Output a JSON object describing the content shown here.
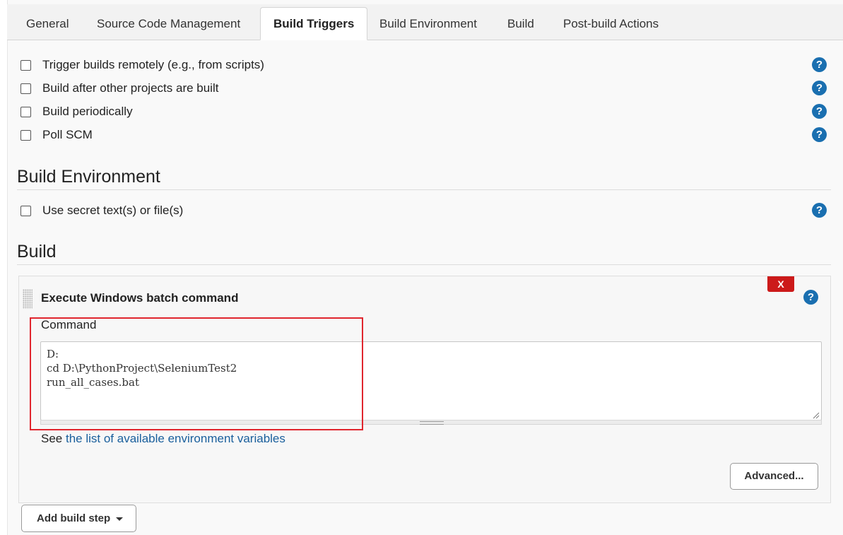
{
  "tabs": [
    {
      "label": "General"
    },
    {
      "label": "Source Code Management"
    },
    {
      "label": "Build Triggers"
    },
    {
      "label": "Build Environment"
    },
    {
      "label": "Build"
    },
    {
      "label": "Post-build Actions"
    }
  ],
  "triggers": [
    {
      "label": "Trigger builds remotely (e.g., from scripts)"
    },
    {
      "label": "Build after other projects are built"
    },
    {
      "label": "Build periodically"
    },
    {
      "label": "Poll SCM"
    }
  ],
  "build_environment": {
    "title": "Build Environment",
    "options": [
      {
        "label": "Use secret text(s) or file(s)"
      }
    ]
  },
  "build": {
    "title": "Build",
    "step": {
      "title": "Execute Windows batch command",
      "delete_label": "X",
      "command_label": "Command",
      "command_value": "D:\ncd D:\\PythonProject\\SeleniumTest2\nrun_all_cases.bat",
      "see_prefix": "See ",
      "see_link": "the list of available environment variables",
      "advanced_label": "Advanced..."
    },
    "add_step_label": "Add build step"
  },
  "help_symbol": "?"
}
